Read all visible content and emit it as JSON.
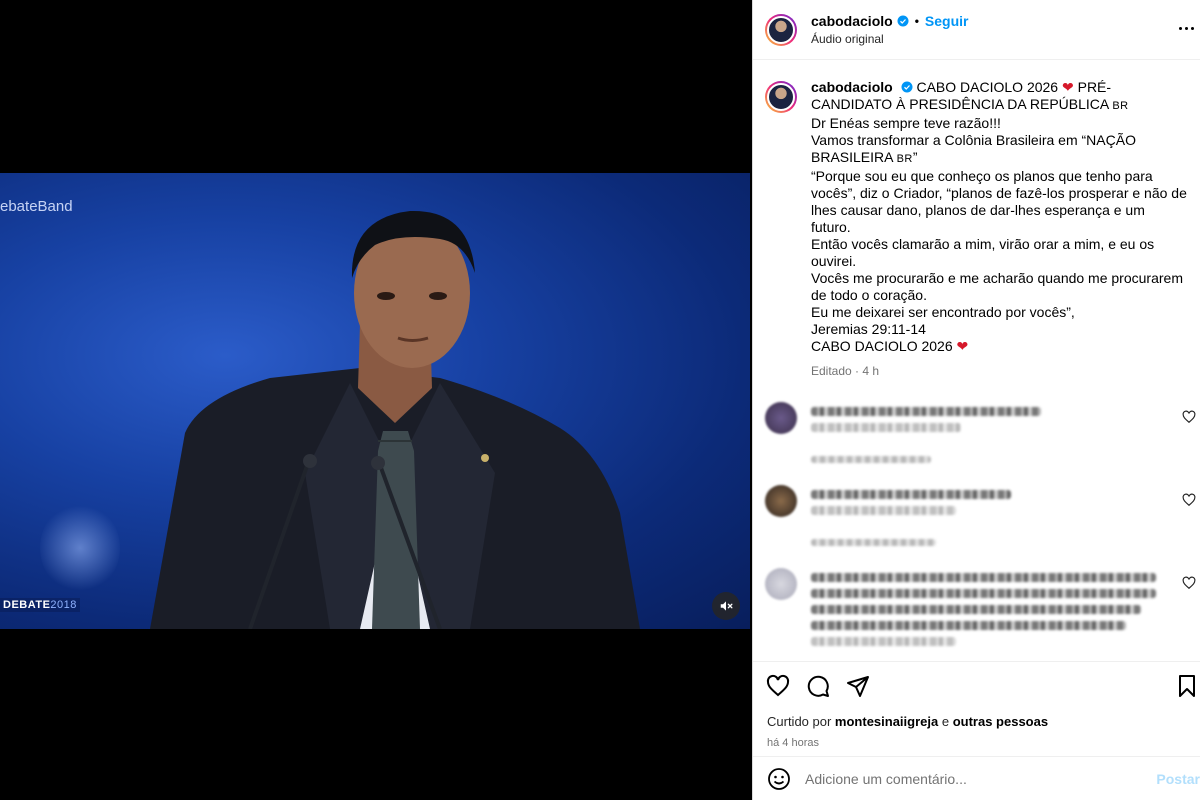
{
  "video": {
    "watermark": "ebateBand",
    "logo_text": "DEBATE",
    "logo_year": "2018",
    "mute_icon": "speaker-muted-icon"
  },
  "post": {
    "username": "cabodaciolo",
    "follow_label": "Seguir",
    "audio_label": "Áudio original",
    "caption": {
      "username": "cabodaciolo",
      "line1": "CABO DACIOLO 2026 ",
      "line1b": " PRÉ-CANDIDATO À PRESIDÊNCIA DA REPÚBLICA ",
      "flag": "BR",
      "lines": [
        "Dr Enéas sempre teve razão!!!",
        "Vamos transformar a Colônia Brasileira em “NAÇÃO BRASILEIRA ",
        "“Porque sou eu que conheço os planos que tenho para vocês”, diz o Criador, “planos de fazê-los prosperar e não de lhes causar dano, planos de dar-lhes esperança e um futuro.",
        "Então vocês clamarão a mim, virão orar a mim, e eu os ouvirei.",
        "Vocês me procurarão e me acharão quando me procurarem de todo o coração.",
        "Eu me deixarei ser encontrado por vocês”,",
        "Jeremias 29:11-14",
        "CABO DACIOLO 2026 "
      ],
      "heart": "❤",
      "quote_close": "”",
      "edited": "Editado · 4 h"
    },
    "liked_by_prefix": "Curtido por ",
    "liked_by_user": "montesinaiigreja",
    "liked_by_and": " e ",
    "liked_by_others": "outras pessoas",
    "time_ago": "há 4 horas",
    "comment_placeholder": "Adicione um comentário...",
    "post_button": "Postar"
  },
  "colors": {
    "accent": "#0095f6",
    "heart": "#d6192b",
    "post_disabled": "#b2dffc"
  }
}
